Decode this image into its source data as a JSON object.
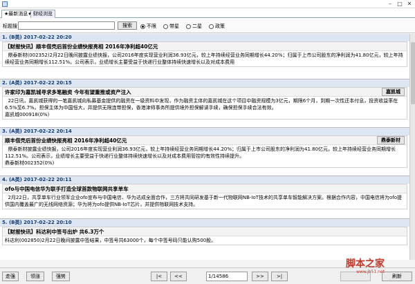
{
  "window": {
    "minimize": "–",
    "maximize": "□",
    "close": "✕"
  },
  "tabs": [
    {
      "label": "★最新消息★"
    },
    {
      "label": "财经浏览"
    }
  ],
  "search": {
    "label": "标题搜：",
    "value": "",
    "button": "搜索",
    "options": [
      {
        "label": "不限",
        "selected": true
      },
      {
        "label": "带星",
        "selected": false
      },
      {
        "label": "二星",
        "selected": false
      },
      {
        "label": "政策",
        "selected": false
      }
    ]
  },
  "items": [
    {
      "head": "1. (B类) 2017-02-22 20:20",
      "title": "【财报快讯】顺丰借壳后首份业绩快报亮相  2016年净利超40亿元",
      "tag": "",
      "text": "  鼎泰新材(002352)2月22日晚间披露业绩快报，公司2016年度实现营业利润36.93亿元，较上年持续经营业务同期增长44.20%；归属于上市公司股东的净利润为41.80亿元，较上年持续经营业务同期增长112.51%。公司表示，业绩增长主要受益于快递行业整体持续快速增长以及对成本费用"
    },
    {
      "head": "2. (A类) 2017-02-22 20:15",
      "title": "许家印为嘉凯城寻求多笔融资  今年有望重推或资产注入",
      "tag": "嘉凯城",
      "text": "  22日讯，嘉凯城获得的一笔嘉凯城向私募基金提供的融资在一级资料中发现，作为融资主体的嘉凯城在这个项目中融资规模为3亿元，期限6个月，到期一次性还本付息，投资收益率在6.5%至6.7%。担保主体为中国恒大，并提供无限连带担保，香港津师事务所提供境外担保解读手续，确保担保手续合法有效。\n嘉凯城000918(0%)"
    },
    {
      "head": "3. (A类) 2017-02-22 20:14",
      "title": "顺丰借壳后首份业绩快报亮相  2016年净利超40亿元",
      "tag": "鼎泰新材",
      "text": "  鼎泰新材披露业绩快报，公司2016年度实现营业利润36.93亿元，较上年持续经营业务同期增长44.20%；归属于上市公司股东的净利润为41.80亿元，较上年持续经营业务同期增长112.51%。公司表示，业绩增长主要受益于快递行业整体持续快速增长以及对成本费用管控的有效性持续提升。\n鼎泰新材002352(0%)"
    },
    {
      "head": "4. (A类) 2017-02-22 20:11",
      "title": "ofo与中国电信华为联手打造全球首款物联网共享单车",
      "tag": "",
      "text": "  2月22日，共享单车行业领军企业ofo宣布与中国电信、华为达成全面合作，三方将共同研发基于新一代物联网NB-IoT技术的共享单车智能解决方案。根据合作内容，中国电信将为ofo提供国内覆盖最广的无线网络资源；华为将为ofo提供NB-IoT芯片，并提供物联网技术支持。"
    },
    {
      "head": "5. (B类) 2017-02-22 20:10",
      "title": "【财报快讯】科达利中签号出炉  共6.3万个",
      "tag": "",
      "text": "科达利(002850)2月22日晚间披露中签结果，中签号共63000个，每个中签号码只能认购500股。"
    }
  ],
  "footer": {
    "buttons": [
      "走强",
      "领涨",
      "强势"
    ],
    "nav": [
      "|<",
      "<<",
      ">>",
      ">|"
    ],
    "page": "1/14586",
    "refresh": "刷新"
  },
  "watermark": {
    "main": "脚本之家",
    "sub": "www.jb51.net"
  }
}
